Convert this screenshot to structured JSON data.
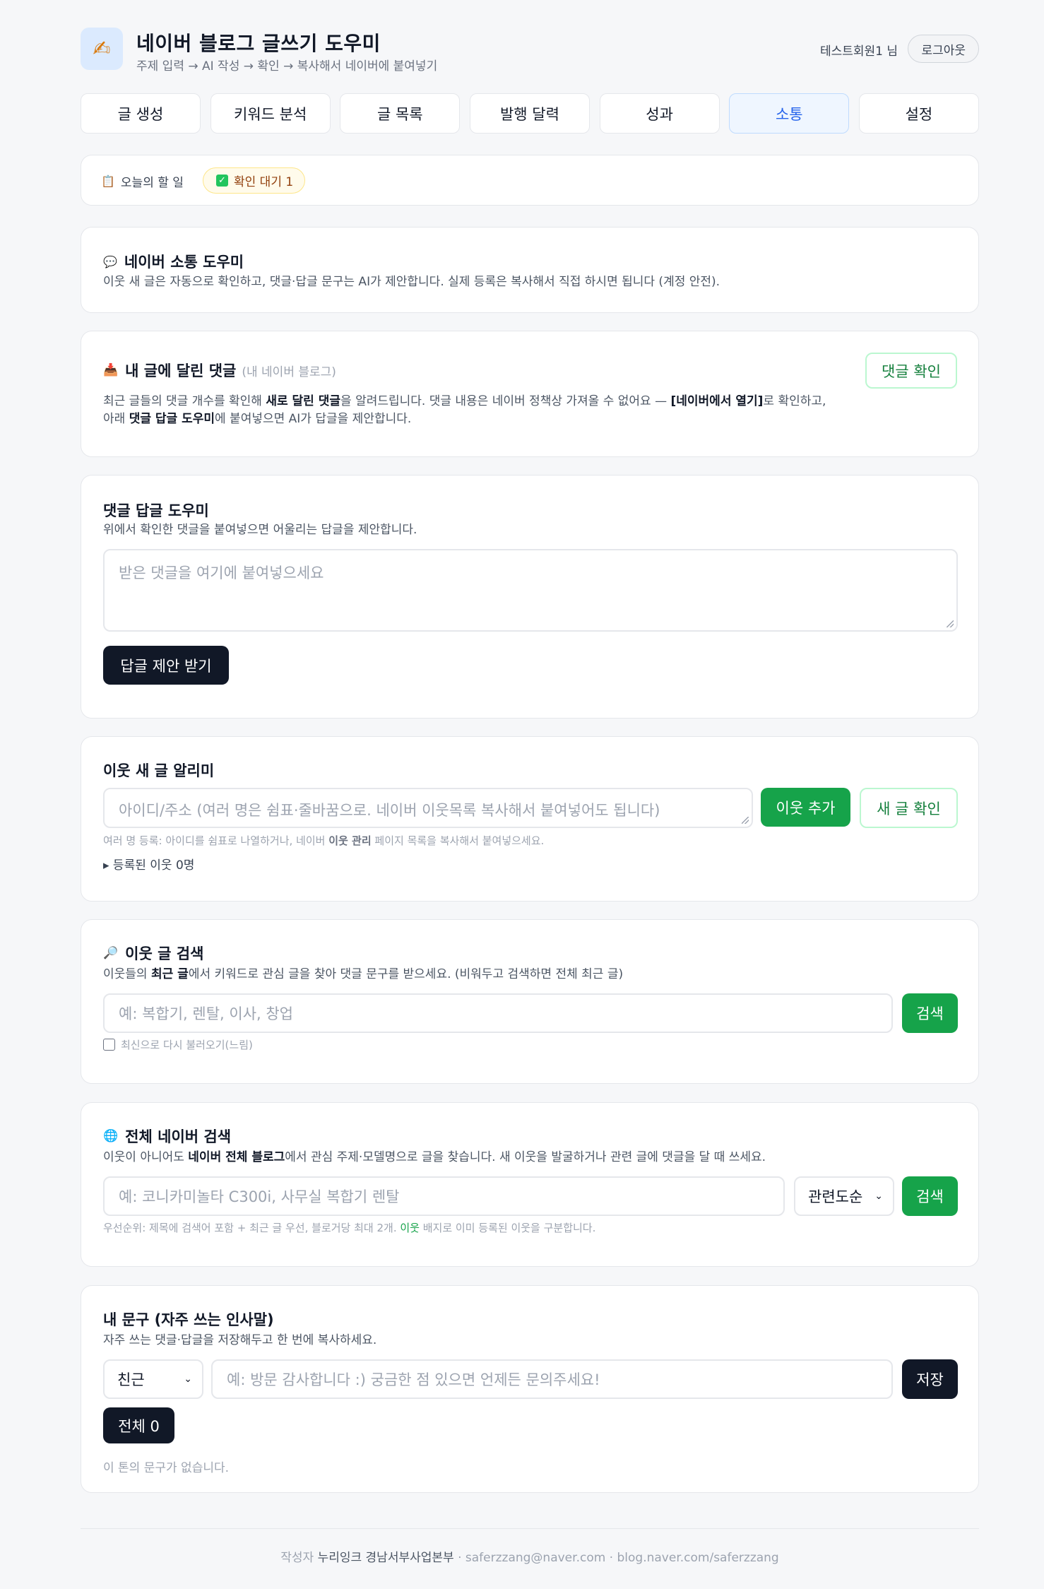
{
  "header": {
    "logo_icon": "writing-hand-icon",
    "title": "네이버 블로그 글쓰기 도우미",
    "subtitle": "주제 입력 → AI 작성 → 확인 → 복사해서 네이버에 붙여넣기",
    "user": "테스트회원1 님",
    "logout": "로그아웃"
  },
  "tabs": [
    {
      "label": "글 생성",
      "active": false
    },
    {
      "label": "키워드 분석",
      "active": false
    },
    {
      "label": "글 목록",
      "active": false
    },
    {
      "label": "발행 달력",
      "active": false
    },
    {
      "label": "성과",
      "active": false
    },
    {
      "label": "소통",
      "active": true
    },
    {
      "label": "설정",
      "active": false
    }
  ],
  "todo": {
    "icon": "clipboard-icon",
    "label": "오늘의 할 일",
    "badge_icon": "check-box-icon",
    "badge": "확인 대기 1"
  },
  "intro": {
    "icon": "speech-bubble-icon",
    "title": "네이버 소통 도우미",
    "desc": "이웃 새 글은 자동으로 확인하고, 댓글·답글 문구는 AI가 제안합니다. 실제 등록은 복사해서 직접 하시면 됩니다 (계정 안전)."
  },
  "my_comments": {
    "icon": "inbox-tray-icon",
    "title": "내 글에 달린 댓글",
    "title_note": "(내 네이버 블로그)",
    "check_button": "댓글 확인",
    "desc_1": "최근 글들의 댓글 개수를 확인해 ",
    "desc_1_bold": "새로 달린 댓글",
    "desc_2": "을 알려드립니다. 댓글 내용은 네이버 정책상 가져올 수 없어요 — ",
    "desc_2_bold": "[네이버에서 열기]",
    "desc_3": "로 확인하고,",
    "desc_4": "아래 ",
    "desc_4_bold": "댓글 답글 도우미",
    "desc_5": "에 붙여넣으면 AI가 답글을 제안합니다."
  },
  "reply_helper": {
    "title": "댓글 답글 도우미",
    "desc": "위에서 확인한 댓글을 붙여넣으면 어울리는 답글을 제안합니다.",
    "placeholder": "받은 댓글을 여기에 붙여넣으세요",
    "button": "답글 제안 받기"
  },
  "neighbor_alert": {
    "title": "이웃 새 글 알리미",
    "placeholder": "아이디/주소 (여러 명은 쉼표·줄바꿈으로. 네이버 이웃목록 복사해서 붙여넣어도 됩니다)",
    "add_button": "이웃 추가",
    "check_button": "새 글 확인",
    "hint_1": "여러 명 등록: 아이디를 쉼표로 나열하거나, 네이버 ",
    "hint_bold": "이웃 관리",
    "hint_2": " 페이지 목록을 복사해서 붙여넣으세요.",
    "registered": "▸ 등록된 이웃 0명"
  },
  "neighbor_search": {
    "icon": "magnifier-icon",
    "title": "이웃 글 검색",
    "desc_1": "이웃들의 ",
    "desc_bold": "최근 글",
    "desc_2": "에서 키워드로 관심 글을 찾아 댓글 문구를 받으세요. (비워두고 검색하면 전체 최근 글)",
    "placeholder": "예: 복합기, 렌탈, 이사, 창업",
    "button": "검색",
    "checkbox_label": "최신으로 다시 불러오기(느림)",
    "checkbox_checked": false
  },
  "naver_search": {
    "icon": "globe-icon",
    "title": "전체 네이버 검색",
    "desc_1": "이웃이 아니어도 ",
    "desc_bold": "네이버 전체 블로그",
    "desc_2": "에서 관심 주제·모델명으로 글을 찾습니다. 새 이웃을 발굴하거나 관련 글에 댓글을 달 때 쓰세요.",
    "placeholder": "예: 코니카미놀타 C300i, 사무실 복합기 렌탈",
    "sort": "관련도순",
    "button": "검색",
    "hint_1": "우선순위: 제목에 검색어 포함 + 최근 글 우선, 블로거당 최대 2개. ",
    "hint_green": "이웃",
    "hint_2": " 배지로 이미 등록된 이웃을 구분합니다."
  },
  "phrases": {
    "title": "내 문구 (자주 쓰는 인사말)",
    "desc": "자주 쓰는 댓글·답글을 저장해두고 한 번에 복사하세요.",
    "tone": "친근",
    "placeholder": "예: 방문 감사합니다 :) 궁금한 점 있으면 언제든 문의주세요!",
    "save_button": "저장",
    "filter_button": "전체 0",
    "empty": "이 톤의 문구가 없습니다."
  },
  "footer": {
    "prefix": "작성자 ",
    "author": "누리잉크 경남서부사업본부",
    "sep": " · ",
    "email": "saferzzang@naver.com",
    "blog": "blog.naver.com/saferzzang"
  }
}
